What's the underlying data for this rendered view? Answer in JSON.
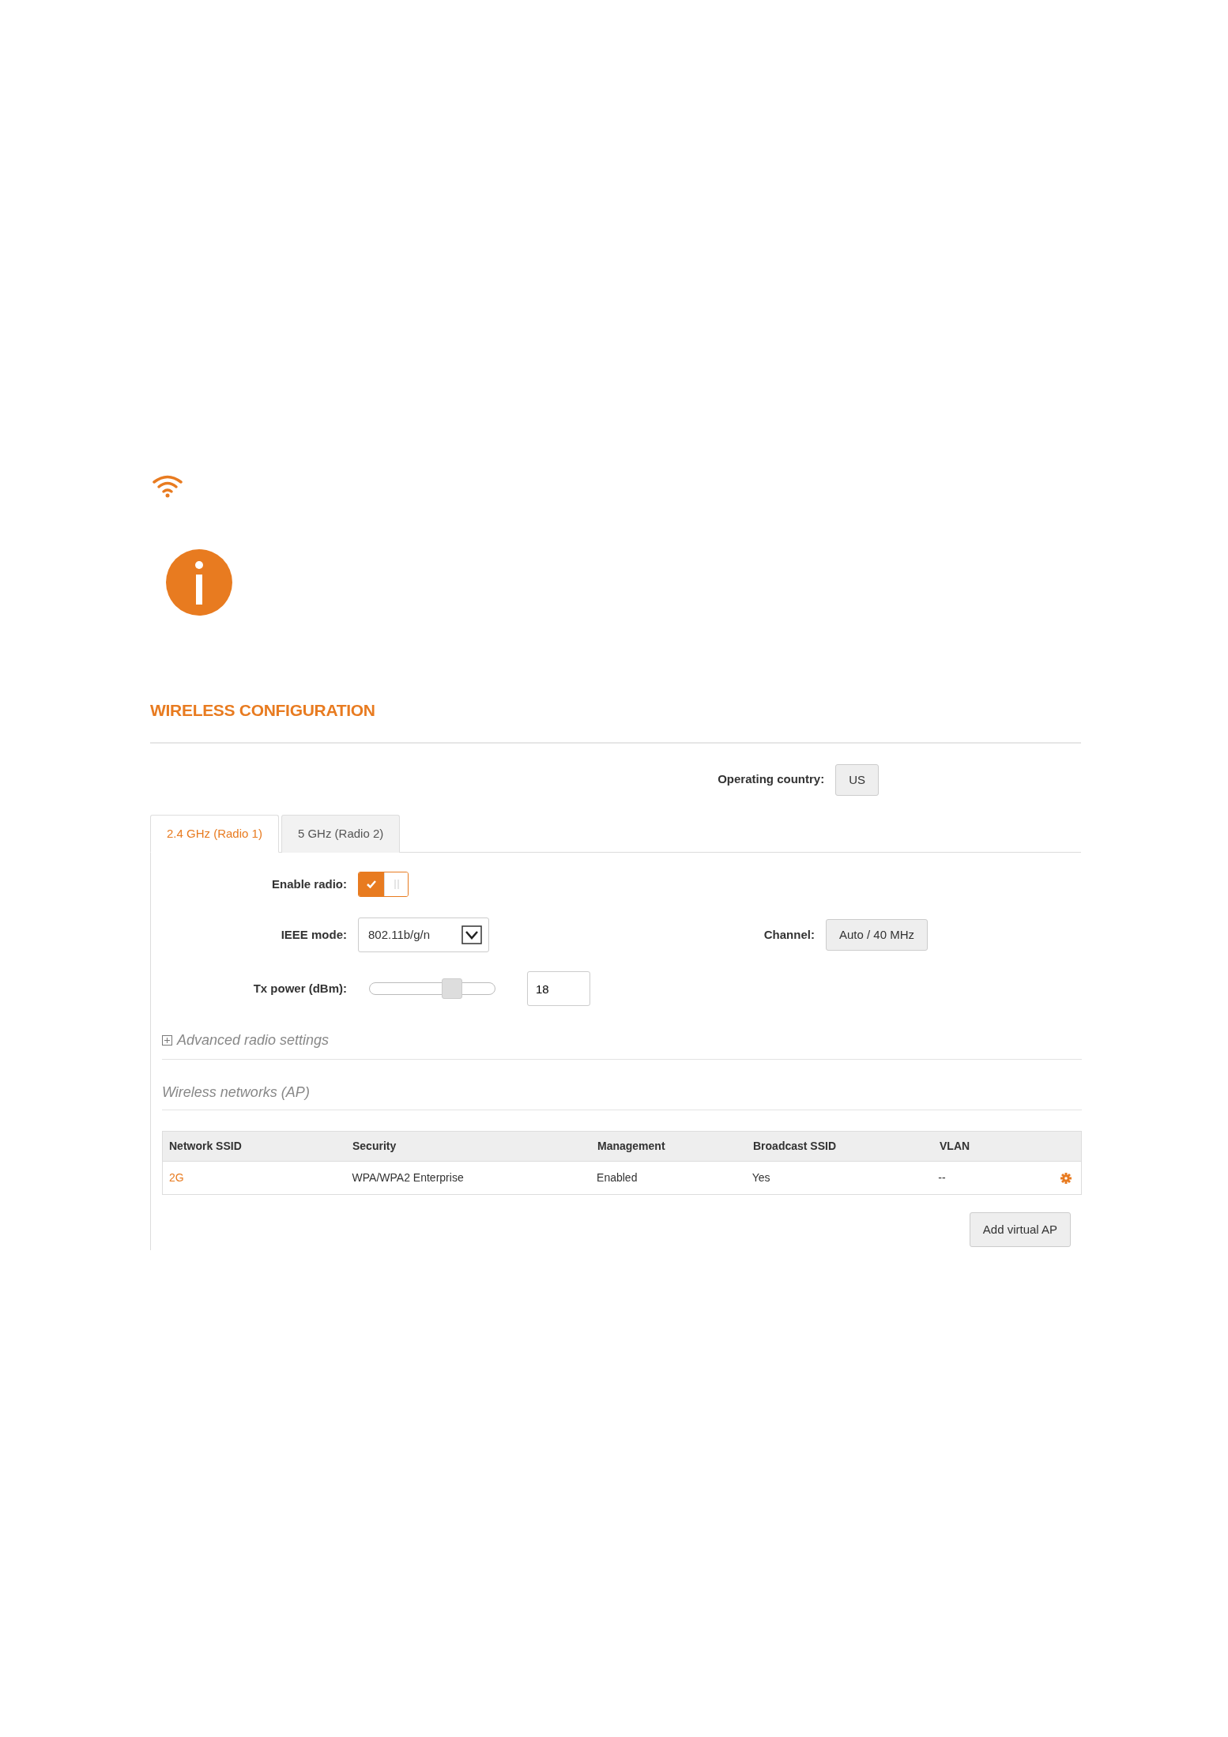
{
  "title": "WIRELESS CONFIGURATION",
  "operating_country": {
    "label": "Operating country:",
    "value": "US"
  },
  "tabs": [
    {
      "label": "2.4 GHz (Radio 1)",
      "selected": true
    },
    {
      "label": "5 GHz (Radio 2)",
      "selected": false
    }
  ],
  "enable_radio": {
    "label": "Enable radio:",
    "on": true
  },
  "ieee_mode": {
    "label": "IEEE mode:",
    "value": "802.11b/g/n"
  },
  "channel": {
    "label": "Channel:",
    "value": "Auto / 40 MHz"
  },
  "tx_power": {
    "label": "Tx power (dBm):",
    "level": 0.66,
    "value": "18"
  },
  "advanced": {
    "label": "Advanced radio settings",
    "expanded": false
  },
  "networks": {
    "title": "Wireless networks (AP)",
    "columns": [
      "Network SSID",
      "Security",
      "Management",
      "Broadcast SSID",
      "VLAN"
    ],
    "rows": [
      {
        "cells": [
          "2G",
          "WPA/WPA2 Enterprise",
          "Enabled",
          "Yes",
          "--"
        ]
      }
    ]
  },
  "add_button": "Add virtual AP"
}
